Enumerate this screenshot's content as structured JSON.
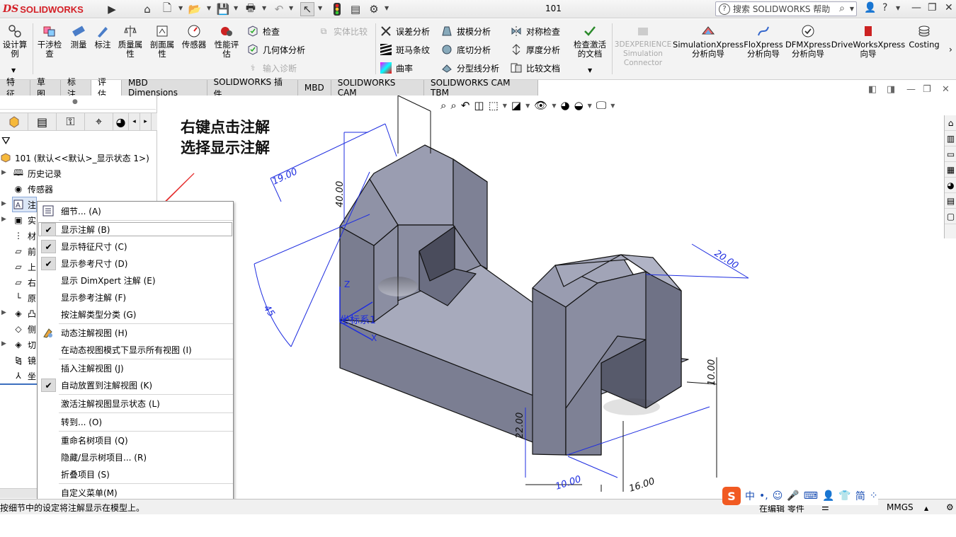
{
  "titlebar": {
    "brand_ds": "DS",
    "brand_name": "SOLIDWORKS",
    "document_title": "101",
    "help_search_placeholder": "搜索 SOLIDWORKS 帮助"
  },
  "ribbon": {
    "design_study": "设计算\n例",
    "interference": "干涉检\n查",
    "measure": "测量",
    "markup": "标注",
    "mass_props": "质量属\n性",
    "section_props": "剖面属\n性",
    "sensor": "传感器",
    "perf_eval": "性能评\n估",
    "check": "检查",
    "geometry_analysis": "几何体分析",
    "import_diagnostics": "输入诊断",
    "compare_bodies": "实体比较",
    "deviation_analysis": "误差分析",
    "zebra": "斑马条纹",
    "curvature": "曲率",
    "draft_analysis": "拔模分析",
    "undercut": "底切分析",
    "parting_line": "分型线分析",
    "symmetry_check": "对称检查",
    "thickness": "厚度分析",
    "compare_docs": "比较文档",
    "check_active": "检查激活\n的文档",
    "connector": "3DEXPERIENCE\nSimulation\nConnector",
    "simxpress": "SimulationXpress\n分析向导",
    "floxpress": "FloXpress\n分析向导",
    "dfmxpress": "DFMXpress\n分析向导",
    "driveworks": "DriveWorksXpress\n向导",
    "costing": "Costing"
  },
  "tabs": [
    "特征",
    "草图",
    "标注",
    "评估",
    "MBD Dimensions",
    "SOLIDWORKS 插件",
    "MBD",
    "SOLIDWORKS CAM",
    "SOLIDWORKS CAM TBM"
  ],
  "tree": {
    "root": "101 (默认<<默认>_显示状态 1>)",
    "history": "历史记录",
    "sensors": "传感器",
    "annotations": "注",
    "solid": "实",
    "material": "材",
    "front": "前",
    "top": "上",
    "right": "右",
    "origin": "原",
    "boss": "凸",
    "side": "侧",
    "cut": "切",
    "mirror": "镜",
    "coord": "坐"
  },
  "instruction": {
    "line1": "右键点击注解",
    "line2": "选择显示注解"
  },
  "context_menu": [
    {
      "label": "细节... (A)",
      "checked": false,
      "icon": "details-icon"
    },
    {
      "label": "显示注解 (B)",
      "checked": true
    },
    {
      "label": "显示特征尺寸 (C)",
      "checked": true
    },
    {
      "label": "显示参考尺寸 (D)",
      "checked": true
    },
    {
      "label": "显示 DimXpert 注解 (E)",
      "checked": false
    },
    {
      "label": "显示参考注解 (F)",
      "checked": false
    },
    {
      "label": "按注解类型分类 (G)",
      "checked": false
    },
    {
      "label": "动态注解视图 (H)",
      "checked": false,
      "icon": "dynamic-view-icon"
    },
    {
      "label": "在动态视图模式下显示所有视图 (I)",
      "checked": false
    },
    {
      "label": "插入注解视图 (J)",
      "checked": false
    },
    {
      "label": "自动放置到注解视图 (K)",
      "checked": true
    },
    {
      "label": "激活注解视图显示状态 (L)",
      "checked": false
    },
    {
      "label": "转到... (O)",
      "checked": false
    },
    {
      "label": "重命名树项目 (Q)",
      "checked": false
    },
    {
      "label": "隐藏/显示树项目... (R)",
      "checked": false
    },
    {
      "label": "折叠项目 (S)",
      "checked": false
    },
    {
      "label": "自定义菜单(M)",
      "checked": false
    }
  ],
  "model": {
    "dim_19": "19.00",
    "dim_40": "40.00",
    "dim_45": "45",
    "dim_20": "20.00",
    "dim_10": "10.00",
    "dim_22": "22.00",
    "dim_bottom1": "10.00",
    "dim_bottom2": "16.00",
    "coord_label": "坐标系1",
    "axis_x": "X",
    "axis_z": "Z"
  },
  "statusbar": {
    "message": "按细节中的设定将注解显示在模型上。",
    "mode": "在编辑 零件",
    "units": "MMGS"
  },
  "ime": {
    "lang": "中",
    "mode": "简"
  }
}
